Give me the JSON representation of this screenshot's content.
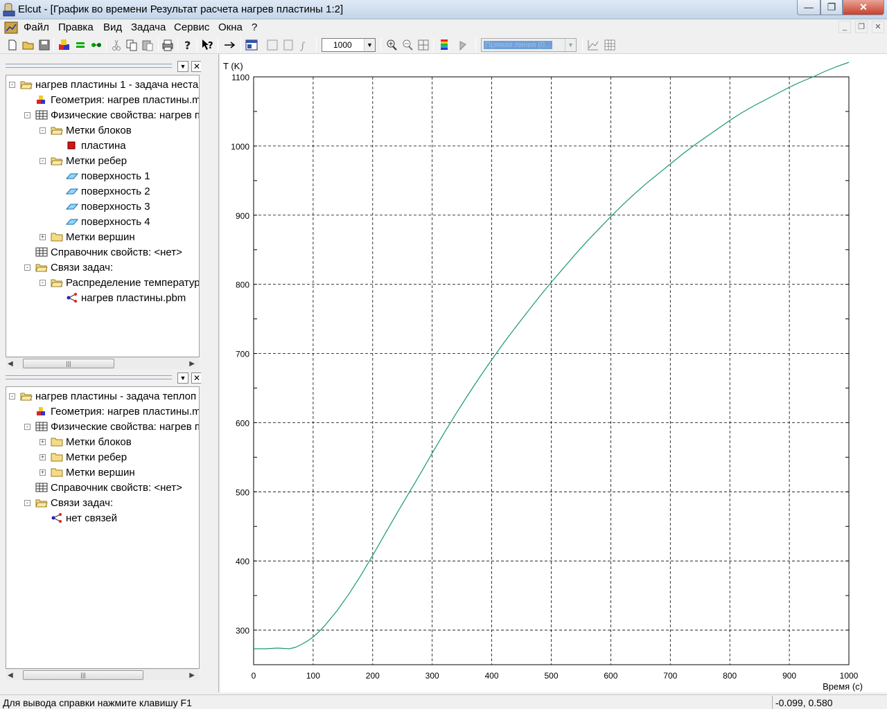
{
  "window": {
    "app_name": "Elcut",
    "title": "Elcut - [График во времени Результат расчета нагрев пластины 1:2]"
  },
  "menu": [
    "Файл",
    "Правка",
    "Вид",
    "Задача",
    "Сервис",
    "Окна",
    "?"
  ],
  "toolbar": {
    "zoom_value": "1000",
    "line_type": "Прямая линия (0..."
  },
  "tree_top": {
    "items": [
      {
        "label": "нагрев пластины 1 -  задача неста",
        "icon": "folder-open-icon",
        "expander": "-"
      },
      {
        "label": "Геометрия: нагрев пластины.m",
        "icon": "geometry-icon",
        "expander": ""
      },
      {
        "label": "Физические свойства: нагрев п",
        "icon": "table-icon",
        "expander": "-"
      },
      {
        "label": "Метки блоков",
        "icon": "folder-open-icon",
        "expander": "-"
      },
      {
        "label": "пластина",
        "icon": "block-label-icon",
        "expander": ""
      },
      {
        "label": "Метки ребер",
        "icon": "folder-open-icon",
        "expander": "-"
      },
      {
        "label": "поверхность 1",
        "icon": "edge-label-icon",
        "expander": ""
      },
      {
        "label": "поверхность 2",
        "icon": "edge-label-icon",
        "expander": ""
      },
      {
        "label": "поверхность 3",
        "icon": "edge-label-icon",
        "expander": ""
      },
      {
        "label": "поверхность 4",
        "icon": "edge-label-icon",
        "expander": ""
      },
      {
        "label": "Метки вершин",
        "icon": "folder-closed-icon",
        "expander": "+"
      },
      {
        "label": "Справочник свойств: <нет>",
        "icon": "table-icon",
        "expander": ""
      },
      {
        "label": "Связи задач:",
        "icon": "folder-open-icon",
        "expander": "-"
      },
      {
        "label": "Распределение температур",
        "icon": "folder-open-icon",
        "expander": "-"
      },
      {
        "label": "нагрев пластины.pbm",
        "icon": "link-icon",
        "expander": ""
      }
    ]
  },
  "tree_bottom": {
    "items": [
      {
        "label": "нагрев пластины -  задача теплоп",
        "icon": "folder-open-icon",
        "expander": "-"
      },
      {
        "label": "Геометрия: нагрев пластины.m",
        "icon": "geometry-icon",
        "expander": ""
      },
      {
        "label": "Физические свойства: нагрев п",
        "icon": "table-icon",
        "expander": "-"
      },
      {
        "label": "Метки блоков",
        "icon": "folder-closed-icon",
        "expander": "+"
      },
      {
        "label": "Метки ребер",
        "icon": "folder-closed-icon",
        "expander": "+"
      },
      {
        "label": "Метки вершин",
        "icon": "folder-closed-icon",
        "expander": "+"
      },
      {
        "label": "Справочник свойств: <нет>",
        "icon": "table-icon",
        "expander": ""
      },
      {
        "label": "Связи задач:",
        "icon": "folder-open-icon",
        "expander": "-"
      },
      {
        "label": "нет связей",
        "icon": "link-icon",
        "expander": ""
      }
    ]
  },
  "status": {
    "help_text": "Для вывода справки нажмите клавишу F1",
    "coordinates": "-0.099, 0.580"
  },
  "chart_data": {
    "type": "line",
    "ylabel": "T (K)",
    "xlabel": "Время (с)",
    "xlim": [
      0,
      1000
    ],
    "ylim": [
      250,
      1100
    ],
    "xticks": [
      0,
      100,
      200,
      300,
      400,
      500,
      600,
      700,
      800,
      900,
      1000
    ],
    "yticks": [
      300,
      400,
      500,
      600,
      700,
      800,
      900,
      1000,
      1100
    ],
    "grid": true,
    "line_color": "#1a9a6a",
    "x": [
      0,
      20,
      40,
      60,
      70,
      80,
      90,
      100,
      110,
      120,
      140,
      160,
      180,
      200,
      220,
      240,
      260,
      280,
      300,
      320,
      340,
      360,
      380,
      400,
      420,
      440,
      460,
      480,
      500,
      520,
      540,
      560,
      580,
      600,
      620,
      640,
      660,
      680,
      700,
      720,
      740,
      760,
      780,
      800,
      820,
      840,
      860,
      880,
      900,
      920,
      940,
      960,
      980,
      1000
    ],
    "y": [
      273,
      273,
      274,
      273,
      275,
      279,
      284,
      290,
      298,
      307,
      328,
      352,
      379,
      408,
      438,
      468,
      497,
      526,
      556,
      585,
      613,
      640,
      666,
      691,
      715,
      738,
      760,
      782,
      803,
      823,
      843,
      862,
      880,
      898,
      915,
      931,
      946,
      960,
      974,
      988,
      1001,
      1013,
      1025,
      1037,
      1048,
      1058,
      1067,
      1076,
      1085,
      1093,
      1100,
      1108,
      1115,
      1121
    ]
  }
}
